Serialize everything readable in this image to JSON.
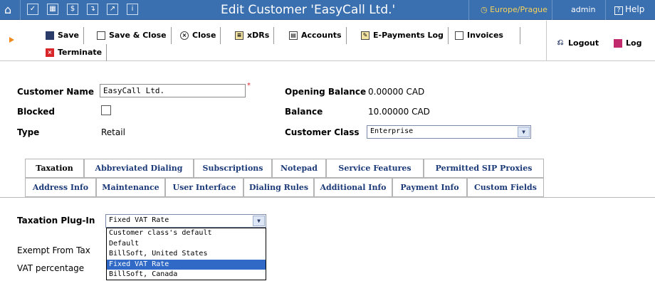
{
  "topbar": {
    "title": "Edit Customer 'EasyCall Ltd.'",
    "timezone": "Europe/Prague",
    "user": "admin",
    "help": "Help"
  },
  "toolbar": {
    "save": "Save",
    "save_close": "Save & Close",
    "close": "Close",
    "xdrs": "xDRs",
    "accounts": "Accounts",
    "epayments": "E-Payments Log",
    "invoices": "Invoices",
    "terminate": "Terminate",
    "logout": "Logout",
    "log": "Log"
  },
  "form": {
    "customer_name_label": "Customer Name",
    "customer_name_value": "EasyCall Ltd.",
    "blocked_label": "Blocked",
    "type_label": "Type",
    "type_value": "Retail",
    "opening_balance_label": "Opening Balance",
    "opening_balance_value": "0.00000 CAD",
    "balance_label": "Balance",
    "balance_value": "10.00000 CAD",
    "customer_class_label": "Customer Class",
    "customer_class_value": "Enterprise"
  },
  "tabs_row1": [
    "Taxation",
    "Abbreviated Dialing",
    "Subscriptions",
    "Notepad",
    "Service Features",
    "Permitted SIP Proxies"
  ],
  "tabs_row2": [
    "Address Info",
    "Maintenance",
    "User Interface",
    "Dialing Rules",
    "Additional Info",
    "Payment Info",
    "Custom Fields"
  ],
  "taxation": {
    "plugin_label": "Taxation Plug-In",
    "plugin_value": "Fixed VAT Rate",
    "exempt_label": "Exempt From Tax",
    "vat_label": "VAT percentage",
    "options": [
      "Customer class's default",
      "Default",
      "BillSoft, United States",
      "Fixed VAT Rate",
      "BillSoft, Canada"
    ],
    "selected_option": "Fixed VAT Rate"
  }
}
